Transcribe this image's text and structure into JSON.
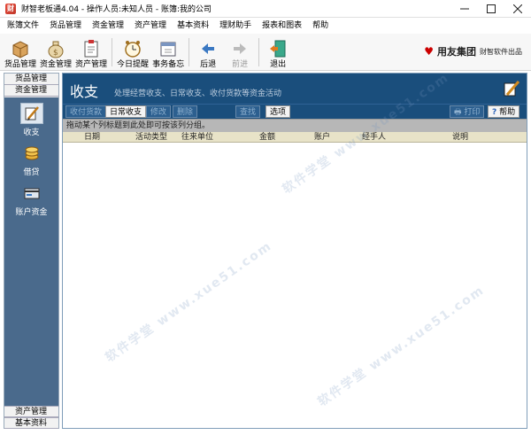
{
  "window": {
    "title": "财智老板通4.04 - 操作人员:未知人员 - 账簿:我的公司",
    "app_icon_glyph": "财"
  },
  "menu": [
    "账簿文件",
    "货品管理",
    "资金管理",
    "资产管理",
    "基本资料",
    "理财助手",
    "报表和图表",
    "帮助"
  ],
  "toolbar": {
    "items": [
      {
        "label": "货品管理",
        "icon": "box-icon"
      },
      {
        "label": "资金管理",
        "icon": "money-bag-icon"
      },
      {
        "label": "资产管理",
        "icon": "clipboard-icon"
      },
      {
        "label": "今日提醒",
        "icon": "clock-icon"
      },
      {
        "label": "事务备忘",
        "icon": "calendar-icon"
      },
      {
        "label": "后退",
        "icon": "back-arrow-icon"
      },
      {
        "label": "前进",
        "icon": "forward-arrow-icon",
        "disabled": true
      },
      {
        "label": "退出",
        "icon": "exit-door-icon"
      }
    ],
    "brand_logo": "♥",
    "brand_main": "用友集团",
    "brand_sub": "财智软件出品"
  },
  "leftnav": {
    "top_groups": [
      "货品管理",
      "资金管理"
    ],
    "entries": [
      {
        "label": "收支",
        "icon": "pen-notebook-icon",
        "active": true
      },
      {
        "label": "借贷",
        "icon": "coins-icon"
      },
      {
        "label": "账户资金",
        "icon": "account-card-icon"
      }
    ],
    "bottom_groups": [
      "资产管理",
      "基本资料"
    ]
  },
  "main": {
    "title": "收支",
    "subtitle": "处理经营收支、日常收支、收付货款等资金活动",
    "tabs": [
      {
        "label": "收付货款",
        "active": false
      },
      {
        "label": "日常收支",
        "active": true
      },
      {
        "label": "修改",
        "active": false
      },
      {
        "label": "删除",
        "active": false
      }
    ],
    "query_label": "查找",
    "options_label": "选项",
    "print_label": "打印",
    "help_label": "帮助",
    "group_hint": "拖动某个列标题到此处即可按该列分组。",
    "columns": [
      "日期",
      "活动类型",
      "往来单位",
      "金额",
      "账户",
      "经手人",
      "说明"
    ]
  },
  "watermark": "软件学堂 www.xue51.com",
  "colors": {
    "header_blue": "#1a4e7c",
    "nav_blue": "#4a6a8c",
    "grid_header": "#e8e3c8"
  }
}
